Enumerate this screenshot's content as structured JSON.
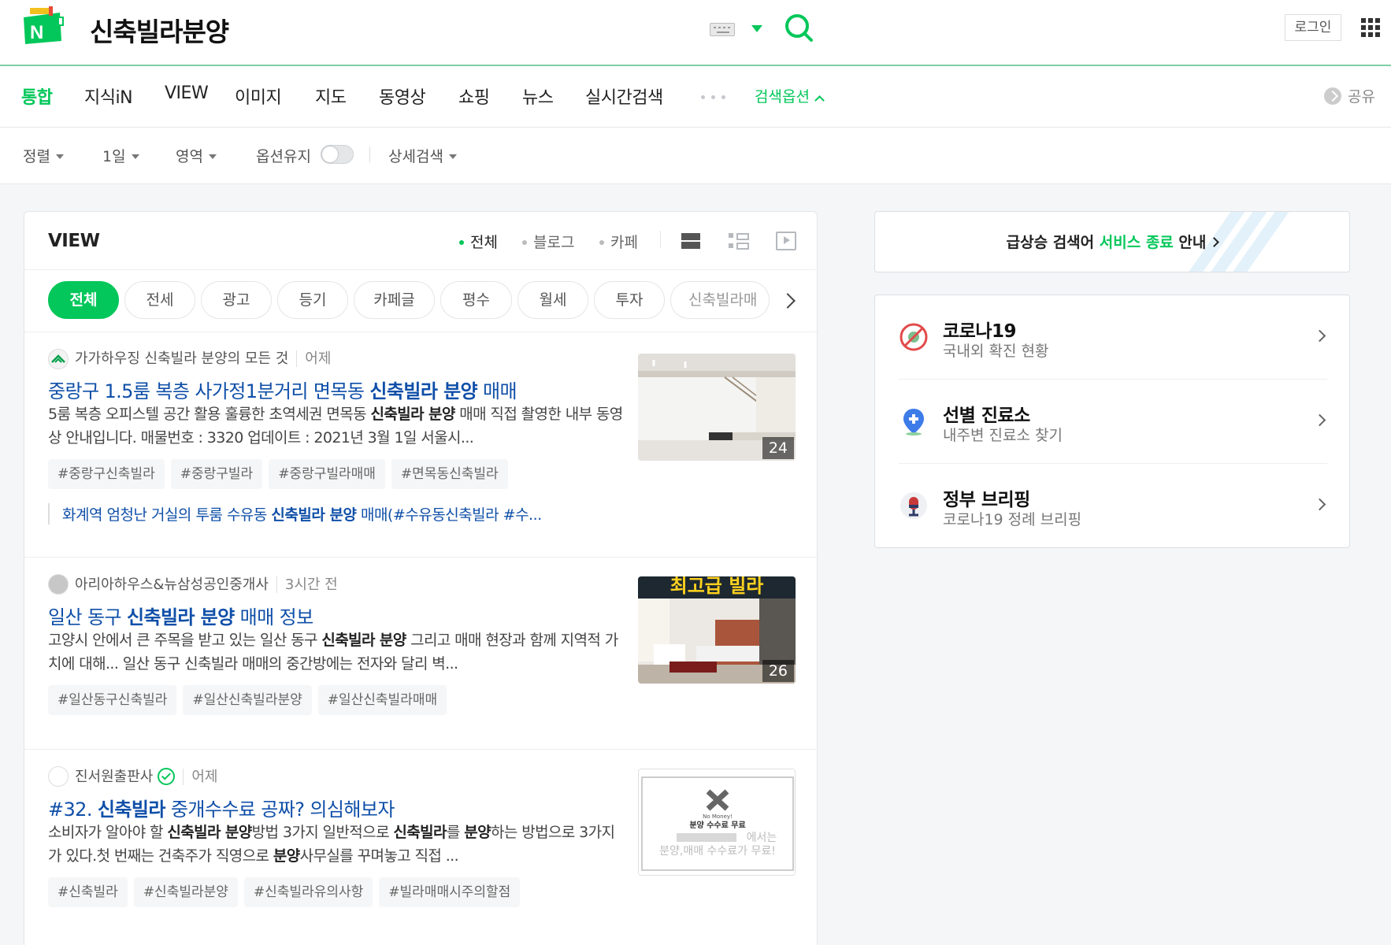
{
  "header": {
    "query": "신축빌라분양",
    "login_label": "로그인"
  },
  "tabs": [
    {
      "label": "통합",
      "active": true
    },
    {
      "label": "지식iN"
    },
    {
      "label": "VIEW"
    },
    {
      "label": "이미지"
    },
    {
      "label": "지도"
    },
    {
      "label": "동영상"
    },
    {
      "label": "쇼핑"
    },
    {
      "label": "뉴스"
    },
    {
      "label": "실시간검색"
    }
  ],
  "search_options_label": "검색옵션",
  "share_label": "공유",
  "options": {
    "sort": "정렬",
    "period": "1일",
    "area": "영역",
    "keep_label": "옵션유지",
    "keep_on": false,
    "detail": "상세검색"
  },
  "view": {
    "title": "VIEW",
    "filters": [
      {
        "label": "전체",
        "active": true
      },
      {
        "label": "블로그"
      },
      {
        "label": "카페"
      }
    ],
    "chips": [
      "전체",
      "전세",
      "광고",
      "등기",
      "카페글",
      "평수",
      "월세",
      "투자",
      "신축빌라매"
    ],
    "items": [
      {
        "source": "가가하우징 신축빌라 분양의 모든 것",
        "time": "어제",
        "title_pre": "중랑구 1.5룸 복층 사가정1분거리 면목동 ",
        "title_bold": "신축빌라 분양",
        "title_post": " 매매",
        "desc_a": "5룸 복층 오피스텔 공간 활용 훌륭한 초역세권 면목동 ",
        "desc_b": "신축빌라 분양",
        "desc_c": " 매매 직접 촬영한 내부 동영상 안내입니다. 매물번호 : 3320 업데이트 : 2021년 3월 1일 서울시...",
        "tags": [
          "#중랑구신축빌라",
          "#중랑구빌라",
          "#중랑구빌라매매",
          "#면목동신축빌라"
        ],
        "sub_pre": "화계역 엄청난 거실의 투룸 수유동 ",
        "sub_bold": "신축빌라 분양",
        "sub_post": " 매매(#수유동신축빌라 #수...",
        "thumb_count": "24"
      },
      {
        "source": "아리아하우스&뉴삼성공인중개사",
        "time": "3시간 전",
        "title_pre": "일산 동구 ",
        "title_bold": "신축빌라 분양",
        "title_post": " 매매 정보",
        "desc_a": "고양시 안에서 큰 주목을 받고 있는 일산 동구 ",
        "desc_b": "신축빌라 분양",
        "desc_c": " 그리고 매매 현장과 함께 지역적 가치에 대해... 일산 동구 신축빌라 매매의 중간방에는 전자와 달리 벽...",
        "tags": [
          "#일산동구신축빌라",
          "#일산신축빌라분양",
          "#일산신축빌라매매"
        ],
        "thumb_banner": "최고급 빌라",
        "thumb_count": "26"
      },
      {
        "source": "진서원출판사",
        "time": "어제",
        "title_pre": "#32. ",
        "title_bold": "신축빌라",
        "title_post": " 중개수수료 공짜? 의심해보자",
        "desc_1": "소비자가 알아야 할 ",
        "desc_2": "신축빌라 분양",
        "desc_3": "방법 3가지 일반적으로 ",
        "desc_4": "신축빌라",
        "desc_5": "를 ",
        "desc_6": "분양",
        "desc_7": "하는 방법으로 3가지가 있다.첫 번째는 건축주가 직영으로 ",
        "desc_8": "분양",
        "desc_9": "사무실를 꾸며놓고 직접 ...",
        "tags": [
          "#신축빌라",
          "#신축빌라분양",
          "#신축빌라유의사항",
          "#빌라매매시주의할점"
        ],
        "thumb_small": "No Money!",
        "thumb_caption": "분양 수수료 무료",
        "thumb_line2": "에서는",
        "thumb_line3": "분양,매매 수수료가 무료!"
      }
    ]
  },
  "notice": {
    "pre": "급상승 검색어 ",
    "green": "서비스 종료",
    "post": " 안내"
  },
  "covid": [
    {
      "title": "코로나19",
      "sub": "국내외 확진 현황",
      "icon": "virus-icon"
    },
    {
      "title": "선별 진료소",
      "sub": "내주변 진료소 찾기",
      "icon": "location-plus-icon"
    },
    {
      "title": "정부 브리핑",
      "sub": "코로나19 정례 브리핑",
      "icon": "microphone-icon"
    }
  ],
  "colors": {
    "brand": "#03c75a",
    "link": "#0f4fa8"
  }
}
